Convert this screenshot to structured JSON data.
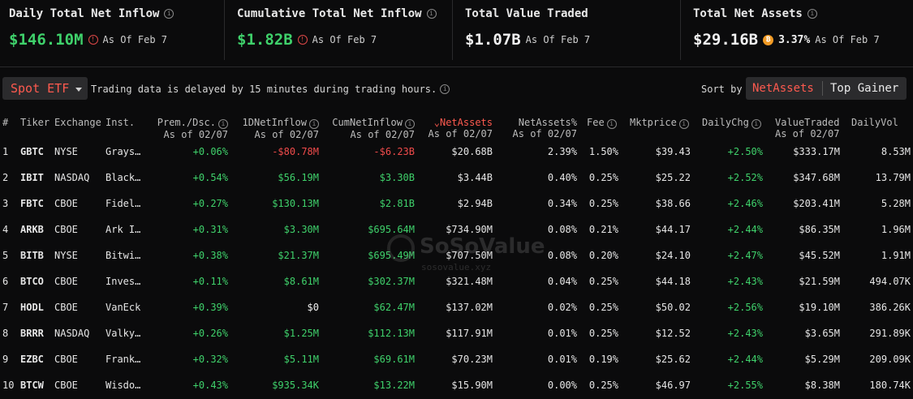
{
  "summary": [
    {
      "title": "Daily Total Net Inflow",
      "value": "$146.10M",
      "value_color": "green",
      "asof": "As Of Feb 7",
      "title_info": true,
      "warn": true
    },
    {
      "title": "Cumulative Total Net Inflow",
      "value": "$1.82B",
      "value_color": "green",
      "asof": "As Of Feb 7",
      "title_info": true,
      "warn": true
    },
    {
      "title": "Total Value Traded",
      "value": "$1.07B",
      "value_color": "white",
      "asof": "As Of Feb 7",
      "title_info": false,
      "warn": false
    },
    {
      "title": "Total Net Assets",
      "value": "$29.16B",
      "value_color": "white",
      "asof": "As Of Feb 7",
      "title_info": true,
      "warn": false,
      "btc_pct": "3.37%",
      "btc_icon": "bitcoin-icon"
    }
  ],
  "toolbar": {
    "etf_select": "Spot ETF",
    "delay_note": "Trading data is delayed by 15 minutes during trading hours.",
    "sort_label": "Sort by",
    "sort_options": [
      "NetAssets",
      "Top Gainer"
    ],
    "active_sort": "NetAssets"
  },
  "table": {
    "headers": {
      "idx": "#",
      "ticker": "Tiker",
      "exchange": "Exchange",
      "inst": "Inst.",
      "prem": "Prem./Dsc.",
      "prem_sub": "As of 02/07",
      "dnet": "1DNetInflow",
      "dnet_sub": "As of 02/07",
      "cnet": "CumNetInflow",
      "cnet_sub": "As of 02/07",
      "na": "NetAssets",
      "na_sub": "As of 02/07",
      "nap": "NetAssets%",
      "nap_sub": "As of 02/07",
      "fee": "Fee",
      "mkt": "Mktprice",
      "chg": "DailyChg",
      "vt": "ValueTraded",
      "vt_sub": "As of 02/07",
      "dv": "DailyVol"
    },
    "rows": [
      {
        "idx": "1",
        "ticker": "GBTC",
        "exchange": "NYSE",
        "inst": "Grays…",
        "prem": "+0.06%",
        "dnet": "-$80.78M",
        "dnet_c": "red",
        "cnet": "-$6.23B",
        "cnet_c": "red",
        "na": "$20.68B",
        "nap": "2.39%",
        "fee": "1.50%",
        "mkt": "$39.43",
        "chg": "+2.50%",
        "vt": "$333.17M",
        "dv": "8.53M"
      },
      {
        "idx": "2",
        "ticker": "IBIT",
        "exchange": "NASDAQ",
        "inst": "Black…",
        "prem": "+0.54%",
        "dnet": "$56.19M",
        "dnet_c": "green",
        "cnet": "$3.30B",
        "cnet_c": "green",
        "na": "$3.44B",
        "nap": "0.40%",
        "fee": "0.25%",
        "mkt": "$25.22",
        "chg": "+2.52%",
        "vt": "$347.68M",
        "dv": "13.79M"
      },
      {
        "idx": "3",
        "ticker": "FBTC",
        "exchange": "CBOE",
        "inst": "Fidel…",
        "prem": "+0.27%",
        "dnet": "$130.13M",
        "dnet_c": "green",
        "cnet": "$2.81B",
        "cnet_c": "green",
        "na": "$2.94B",
        "nap": "0.34%",
        "fee": "0.25%",
        "mkt": "$38.66",
        "chg": "+2.46%",
        "vt": "$203.41M",
        "dv": "5.28M"
      },
      {
        "idx": "4",
        "ticker": "ARKB",
        "exchange": "CBOE",
        "inst": "Ark I…",
        "prem": "+0.31%",
        "dnet": "$3.30M",
        "dnet_c": "green",
        "cnet": "$695.64M",
        "cnet_c": "green",
        "na": "$734.90M",
        "nap": "0.08%",
        "fee": "0.21%",
        "mkt": "$44.17",
        "chg": "+2.44%",
        "vt": "$86.35M",
        "dv": "1.96M"
      },
      {
        "idx": "5",
        "ticker": "BITB",
        "exchange": "NYSE",
        "inst": "Bitwi…",
        "prem": "+0.38%",
        "dnet": "$21.37M",
        "dnet_c": "green",
        "cnet": "$695.49M",
        "cnet_c": "green",
        "na": "$707.50M",
        "nap": "0.08%",
        "fee": "0.20%",
        "mkt": "$24.10",
        "chg": "+2.47%",
        "vt": "$45.52M",
        "dv": "1.91M"
      },
      {
        "idx": "6",
        "ticker": "BTCO",
        "exchange": "CBOE",
        "inst": "Inves…",
        "prem": "+0.11%",
        "dnet": "$8.61M",
        "dnet_c": "green",
        "cnet": "$302.37M",
        "cnet_c": "green",
        "na": "$321.48M",
        "nap": "0.04%",
        "fee": "0.25%",
        "mkt": "$44.18",
        "chg": "+2.43%",
        "vt": "$21.59M",
        "dv": "494.07K"
      },
      {
        "idx": "7",
        "ticker": "HODL",
        "exchange": "CBOE",
        "inst": "VanEck",
        "prem": "+0.39%",
        "dnet": "$0",
        "dnet_c": "white",
        "cnet": "$62.47M",
        "cnet_c": "green",
        "na": "$137.02M",
        "nap": "0.02%",
        "fee": "0.25%",
        "mkt": "$50.02",
        "chg": "+2.56%",
        "vt": "$19.10M",
        "dv": "386.26K"
      },
      {
        "idx": "8",
        "ticker": "BRRR",
        "exchange": "NASDAQ",
        "inst": "Valky…",
        "prem": "+0.26%",
        "dnet": "$1.25M",
        "dnet_c": "green",
        "cnet": "$112.13M",
        "cnet_c": "green",
        "na": "$117.91M",
        "nap": "0.01%",
        "fee": "0.25%",
        "mkt": "$12.52",
        "chg": "+2.43%",
        "vt": "$3.65M",
        "dv": "291.89K"
      },
      {
        "idx": "9",
        "ticker": "EZBC",
        "exchange": "CBOE",
        "inst": "Frank…",
        "prem": "+0.32%",
        "dnet": "$5.11M",
        "dnet_c": "green",
        "cnet": "$69.61M",
        "cnet_c": "green",
        "na": "$70.23M",
        "nap": "0.01%",
        "fee": "0.19%",
        "mkt": "$25.62",
        "chg": "+2.44%",
        "vt": "$5.29M",
        "dv": "209.09K"
      },
      {
        "idx": "10",
        "ticker": "BTCW",
        "exchange": "CBOE",
        "inst": "Wisdo…",
        "prem": "+0.43%",
        "dnet": "$935.34K",
        "dnet_c": "green",
        "cnet": "$13.22M",
        "cnet_c": "green",
        "na": "$15.90M",
        "nap": "0.00%",
        "fee": "0.25%",
        "mkt": "$46.97",
        "chg": "+2.55%",
        "vt": "$8.38M",
        "dv": "180.74K"
      }
    ]
  },
  "watermark": {
    "brand": "SoSoValue",
    "url": "sosovalue.xyz"
  },
  "colors": {
    "green": "#3fd16b",
    "red": "#f04b4b",
    "accent": "#ff5a4f",
    "bg": "#0b0b0c"
  }
}
